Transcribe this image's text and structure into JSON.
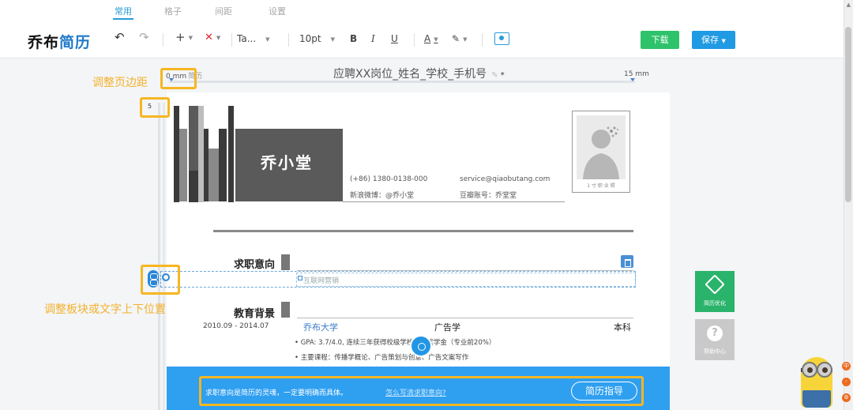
{
  "menu": {
    "tabs": [
      "常用",
      "格子",
      "间距",
      "设置"
    ],
    "active": "常用"
  },
  "toolbar": {
    "logo_part1": "乔布",
    "logo_part2": "简历",
    "undo_icon": "↶",
    "redo_icon": "↷",
    "add_label": "+",
    "delete_label": "✕",
    "font_family": "Ta...",
    "font_size": "10pt",
    "bold": "B",
    "italic": "I",
    "underline": "U",
    "font_color": "A",
    "highlight": "✎",
    "download_label": "下载",
    "save_label": "保存"
  },
  "document": {
    "title": "应聘XX岗位_姓名_学校_手机号",
    "title_mark": "*",
    "margin_left": "0 mm",
    "margin_left_sub": "简历",
    "margin_right": "15 mm",
    "margin_top": "5"
  },
  "resume": {
    "name": "乔小堂",
    "phone": "(+86)  1380-0138-000",
    "email": "service@qiaobutang.com",
    "weibo": "新浪微博：@乔小堂",
    "douban": "豆瓣账号：乔堂堂",
    "photo_caption": "1 寸 职 业 照",
    "sections": {
      "intent_title": "求职意向",
      "intent_value": "互联网营销",
      "education_title": "教育背景"
    },
    "education": {
      "date": "2010.09 - 2014.07",
      "school": "乔布大学",
      "major": "广告学",
      "degree": "本科",
      "bullet1": "• GPA: 3.7/4.0, 连续三年获得校级学校三等奖学金（专业前20%）",
      "bullet2": "• 主要课程：传播学概论、广告策划与创意、广告文案写作"
    }
  },
  "annotations": {
    "margin_label": "调整页边距",
    "move_label": "调整板块或文字上下位置"
  },
  "tip": {
    "text": "求职意向是简历的灵魂，一定要明确而具体。",
    "link": "怎么写清求职意向?",
    "button": "简历指导"
  },
  "side": {
    "optimize_label": "简历优化",
    "help_label": "帮助中心",
    "help_icon": "?"
  },
  "colors": {
    "brand_blue": "#1f9ae3",
    "download_green": "#2ec26a",
    "annotation_orange": "#f6b622",
    "tip_blue": "#2f9ff0"
  }
}
